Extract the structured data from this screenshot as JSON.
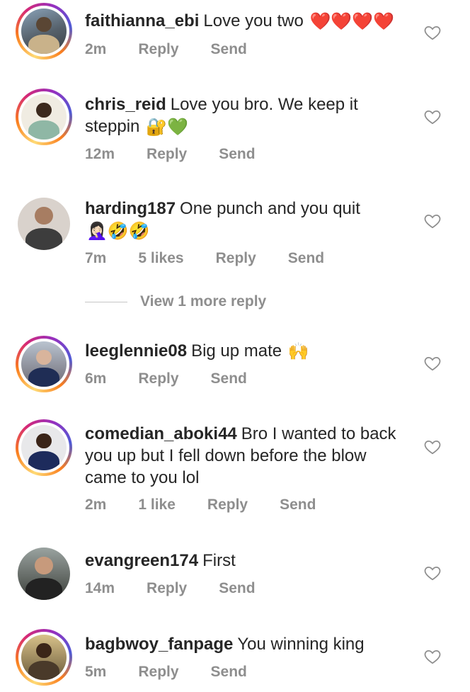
{
  "comments": [
    {
      "username": "faithianna_ebi",
      "text": "Love you two",
      "emoji": "❤️❤️❤️❤️",
      "time": "2m",
      "likes": "",
      "reply": "Reply",
      "send": "Send"
    },
    {
      "username": "chris_reid",
      "text": "Love you bro. We keep it steppin",
      "emoji": "🔐💚",
      "time": "12m",
      "likes": "",
      "reply": "Reply",
      "send": "Send"
    },
    {
      "username": "harding187",
      "text": "One punch and you quit",
      "emoji": "🤦🏻‍♀️🤣🤣",
      "time": "7m",
      "likes": "5 likes",
      "reply": "Reply",
      "send": "Send"
    },
    {
      "username": "leeglennie08",
      "text": "Big up mate",
      "emoji": "🙌",
      "time": "6m",
      "likes": "",
      "reply": "Reply",
      "send": "Send"
    },
    {
      "username": "comedian_aboki44",
      "text": "Bro I wanted to back you up but I fell down before the blow came to you lol",
      "emoji": "",
      "time": "2m",
      "likes": "1 like",
      "reply": "Reply",
      "send": "Send"
    },
    {
      "username": "evangreen174",
      "text": "First",
      "emoji": "",
      "time": "14m",
      "likes": "",
      "reply": "Reply",
      "send": "Send"
    },
    {
      "username": "bagbwoy_fanpage",
      "text": "You winning king",
      "emoji": "",
      "time": "5m",
      "likes": "",
      "reply": "Reply",
      "send": "Send"
    }
  ],
  "view_more_replies": "View 1 more reply",
  "icons": {
    "like": "heart-outline-icon"
  },
  "colors": {
    "meta": "#8e8e8e",
    "text": "#262626",
    "ring": "#d62976"
  }
}
